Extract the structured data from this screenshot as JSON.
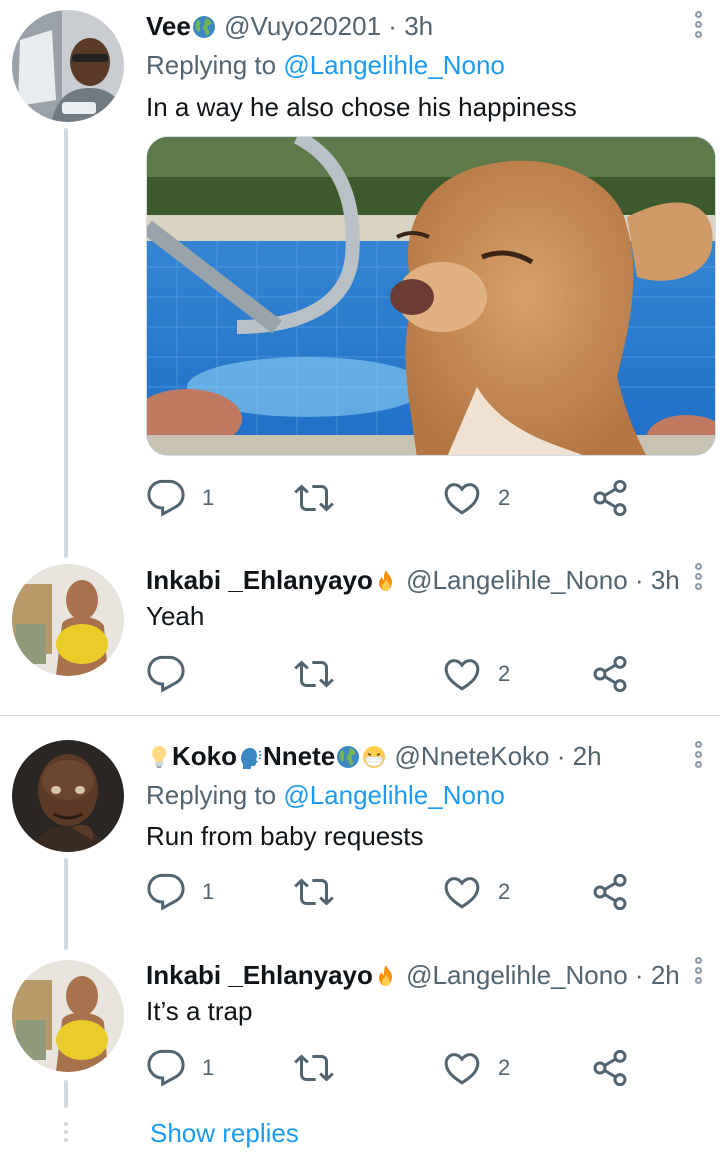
{
  "tweets": [
    {
      "name": "Vee",
      "handle": "@Vuyo20201",
      "sep": "·",
      "time": "3h",
      "replying_prefix": "Replying to ",
      "replying_to": "@Langelihle_Nono",
      "text": "In a way he also chose his happiness",
      "replies": "1",
      "retweets": "",
      "likes": "2",
      "media": "chihuahua-in-pool-photo"
    },
    {
      "name": "Inkabi _Ehlanyayo",
      "handle": "@Langelihle_Nono",
      "sep": "·",
      "time": "3h",
      "text": "Yeah",
      "replies": "",
      "retweets": "",
      "likes": "2"
    },
    {
      "name_prefix": "Koko",
      "name_suffix": "Nnete",
      "handle": "@NneteKoko",
      "sep": "·",
      "time": "2h",
      "replying_prefix": "Replying to ",
      "replying_to": "@Langelihle_Nono",
      "text": "Run from baby requests",
      "replies": "1",
      "retweets": "",
      "likes": "2"
    },
    {
      "name": "Inkabi _Ehlanyayo",
      "handle": "@Langelihle_Nono",
      "sep": "·",
      "time": "2h",
      "text": "It’s a trap",
      "replies": "1",
      "retweets": "",
      "likes": "2"
    }
  ],
  "show_replies": "Show replies",
  "colors": {
    "accent": "#1d9bf0",
    "muted": "#536471",
    "line": "#cfd9de"
  },
  "icons": [
    "reply-icon",
    "retweet-icon",
    "like-icon",
    "share-icon",
    "more-options-icon",
    "globe-emoji-icon",
    "fire-emoji-icon",
    "lightbulb-emoji-icon",
    "speaking-head-emoji-icon",
    "mask-face-emoji-icon"
  ]
}
